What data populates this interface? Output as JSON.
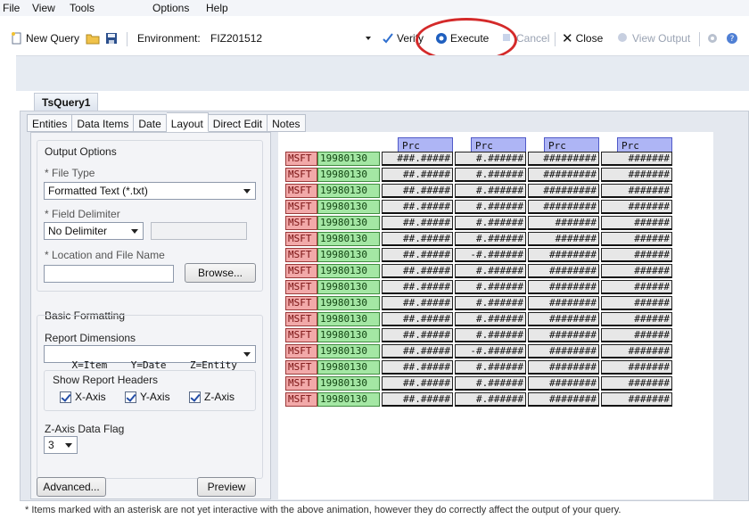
{
  "menu": [
    "File",
    "View",
    "Tools",
    "Options",
    "Help"
  ],
  "toolbar": {
    "new_query": "New Query",
    "environment_label": "Environment:",
    "environment_value": "FIZ201512",
    "verify": "Verify",
    "execute": "Execute",
    "cancel": "Cancel",
    "close": "Close",
    "view_output": "View Output"
  },
  "document_tab": "TsQuery1",
  "tabs": [
    "Entities",
    "Data Items",
    "Date",
    "Layout",
    "Direct Edit",
    "Notes"
  ],
  "active_tab": "Layout",
  "output_options": {
    "title": "Output Options",
    "file_type_label": "* File Type",
    "file_type_value": "Formatted Text (*.txt)",
    "field_delimiter_label": "* Field Delimiter",
    "field_delimiter_value": "No Delimiter",
    "location_label": "* Location and File Name",
    "location_value": "",
    "browse": "Browse..."
  },
  "basic_formatting": {
    "title": "Basic Formatting",
    "report_dimensions_label": "Report Dimensions",
    "report_dimensions_value": "X=Item    Y=Date    Z=Entity",
    "show_headers_label": "Show Report Headers",
    "x_axis": "X-Axis",
    "y_axis": "Y-Axis",
    "z_axis": "Z-Axis",
    "z_axis_flag_label": "Z-Axis Data Flag",
    "z_axis_flag_value": "3"
  },
  "buttons": {
    "advanced": "Advanced...",
    "preview": "Preview"
  },
  "preview": {
    "headers": [
      "Prc",
      "Prc",
      "Prc",
      "Prc"
    ],
    "rows": [
      [
        "MSFT",
        "19980130",
        "###.#####",
        "#.######",
        "#########",
        "#######"
      ],
      [
        "MSFT",
        "19980130",
        "##.#####",
        "#.######",
        "#########",
        "#######"
      ],
      [
        "MSFT",
        "19980130",
        "##.#####",
        "#.######",
        "#########",
        "#######"
      ],
      [
        "MSFT",
        "19980130",
        "##.#####",
        "#.######",
        "#########",
        "#######"
      ],
      [
        "MSFT",
        "19980130",
        "##.#####",
        "#.######",
        "#######",
        "######"
      ],
      [
        "MSFT",
        "19980130",
        "##.#####",
        "#.######",
        "#######",
        "######"
      ],
      [
        "MSFT",
        "19980130",
        "##.#####",
        "-#.######",
        "########",
        "######"
      ],
      [
        "MSFT",
        "19980130",
        "##.#####",
        "#.######",
        "########",
        "######"
      ],
      [
        "MSFT",
        "19980130",
        "##.#####",
        "#.######",
        "########",
        "######"
      ],
      [
        "MSFT",
        "19980130",
        "##.#####",
        "#.######",
        "########",
        "######"
      ],
      [
        "MSFT",
        "19980130",
        "##.#####",
        "#.######",
        "########",
        "######"
      ],
      [
        "MSFT",
        "19980130",
        "##.#####",
        "#.######",
        "########",
        "######"
      ],
      [
        "MSFT",
        "19980130",
        "##.#####",
        "-#.######",
        "########",
        "#######"
      ],
      [
        "MSFT",
        "19980130",
        "##.#####",
        "#.######",
        "########",
        "#######"
      ],
      [
        "MSFT",
        "19980130",
        "##.#####",
        "#.######",
        "########",
        "#######"
      ],
      [
        "MSFT",
        "19980130",
        "##.#####",
        "#.######",
        "########",
        "#######"
      ]
    ]
  },
  "footnote": "* Items marked with an asterisk are not yet interactive with the above animation, however they do correctly affect the output of your query.",
  "colors": {
    "highlight_ellipse": "#d42a2a",
    "header_fill": "#aeb5f5",
    "entity_fill": "#f2a9a9",
    "date_fill": "#a4e7a4",
    "value_fill": "#e7e7e7"
  }
}
